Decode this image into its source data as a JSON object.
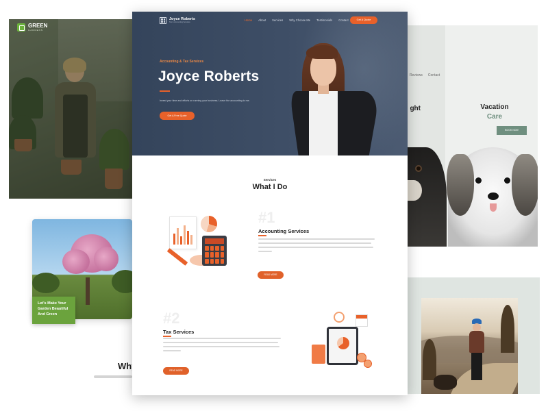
{
  "garden": {
    "logo_name": "GREEN",
    "logo_sub": "GARDENS",
    "badge_text": "Let's Make Your Garden Beautiful And Green",
    "why_text": "Why"
  },
  "pet": {
    "nav": [
      "Reviews",
      "Contact"
    ],
    "title_left": "ght",
    "title_main_line1": "Vacation",
    "title_main_line2": "Care",
    "button_label": "BOOK NOW"
  },
  "hike": {
    "button_label": "READ MORE"
  },
  "main": {
    "logo": {
      "name": "Joyce Roberts",
      "tagline": "Tax & Accounting Services"
    },
    "nav": [
      {
        "label": "Home",
        "active": true
      },
      {
        "label": "About",
        "active": false
      },
      {
        "label": "Services",
        "active": false
      },
      {
        "label": "Why Choose Me",
        "active": false
      },
      {
        "label": "Testimonials",
        "active": false
      },
      {
        "label": "Contact",
        "active": false
      }
    ],
    "cta": "Get A Quote",
    "hero": {
      "eyebrow": "Accounting & Tax Services",
      "title": "Joyce Roberts",
      "description": "Invest your time and efforts on running your business. Leave the accounting to me.",
      "button": "Get A Free Quote"
    },
    "services": {
      "eyebrow": "Services",
      "title": "What I Do",
      "items": [
        {
          "number": "#1",
          "title": "Accounting Services",
          "button": "READ MORE"
        },
        {
          "number": "#2",
          "title": "Tax Services",
          "button": "READ MORE"
        }
      ]
    }
  },
  "colors": {
    "accent": "#e8612a",
    "hero_bg": "#3e4e66",
    "garden_green": "#6ba33d",
    "pet_green": "#6f8f7f"
  }
}
